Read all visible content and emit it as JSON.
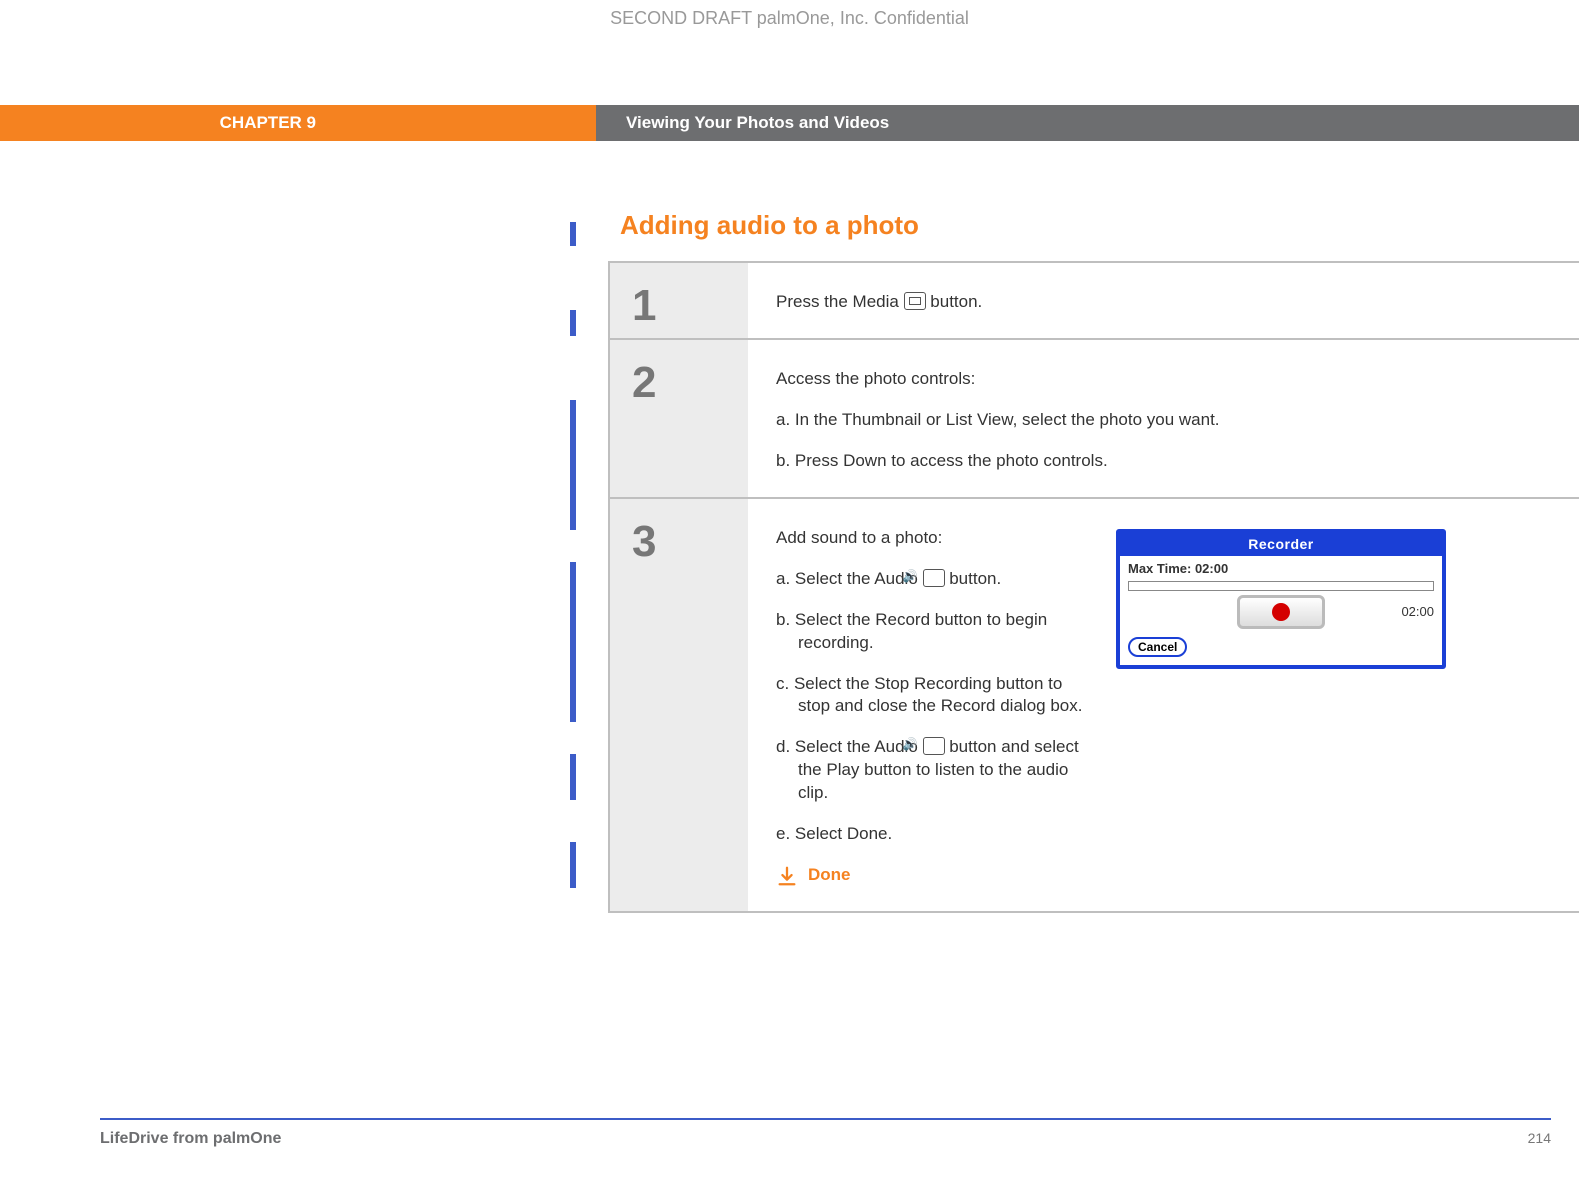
{
  "watermark": "SECOND DRAFT palmOne, Inc.  Confidential",
  "chapter_label": "CHAPTER 9",
  "chapter_title": "Viewing Your Photos and Videos",
  "section_title": "Adding audio to a photo",
  "steps": {
    "s1": {
      "num": "1",
      "line_pre": "Press the Media ",
      "line_post": " button."
    },
    "s2": {
      "num": "2",
      "intro": "Access the photo controls:",
      "a": "a.  In the Thumbnail or List View, select the photo you want.",
      "b": "b.  Press Down to access the photo controls."
    },
    "s3": {
      "num": "3",
      "intro": "Add sound to a photo:",
      "a_pre": "a.  Select the Audio ",
      "a_post": " button.",
      "b": "b.  Select the Record button to begin recording.",
      "c": "c.  Select the Stop Recording button to stop and close the Record dialog box.",
      "d_pre": "d.  Select the Audio ",
      "d_post": " button and select the Play button to listen to the audio clip.",
      "e": "e.  Select Done."
    }
  },
  "recorder": {
    "title": "Recorder",
    "max_label": "Max Time:  02:00",
    "time": "02:00",
    "cancel": "Cancel"
  },
  "done_label": "Done",
  "footer_product": "LifeDrive from palmOne",
  "footer_page": "214"
}
